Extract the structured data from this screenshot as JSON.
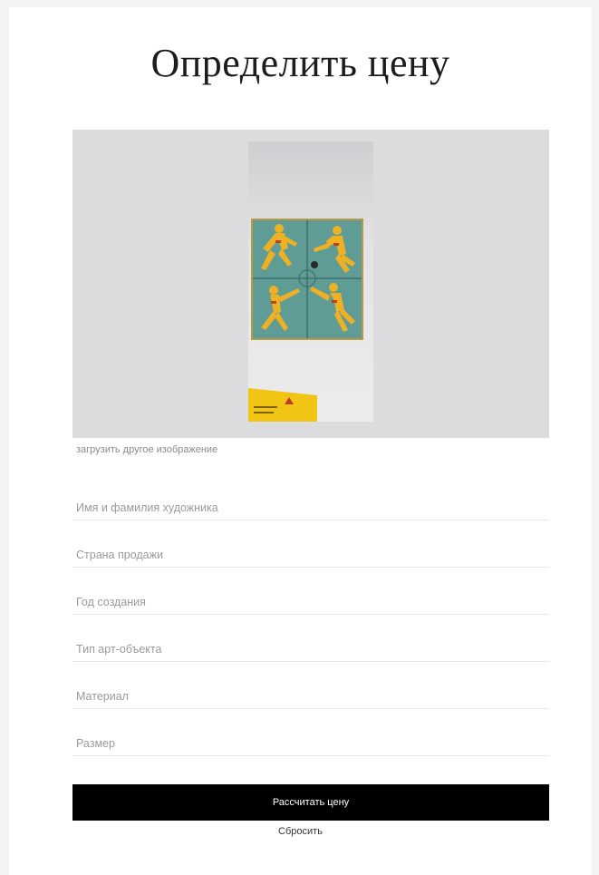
{
  "page": {
    "title": "Определить цену"
  },
  "upload": {
    "reupload_link": "загрузить другое изображение"
  },
  "form": {
    "fields": [
      {
        "placeholder": "Имя и фамилия художника",
        "value": ""
      },
      {
        "placeholder": "Страна продажи",
        "value": ""
      },
      {
        "placeholder": "Год создания",
        "value": ""
      },
      {
        "placeholder": "Тип арт-объекта",
        "value": ""
      },
      {
        "placeholder": "Материал",
        "value": ""
      },
      {
        "placeholder": "Размер",
        "value": ""
      }
    ],
    "submit_label": "Рассчитать цену",
    "reset_label": "Сбросить"
  },
  "colors": {
    "background": "#f3f3f4",
    "card": "#ffffff",
    "upload_area": "#dcdcde",
    "button": "#000000",
    "button_text": "#ffffff",
    "painting_ground": "#5f9c95",
    "painting_figures": "#eeb024"
  }
}
